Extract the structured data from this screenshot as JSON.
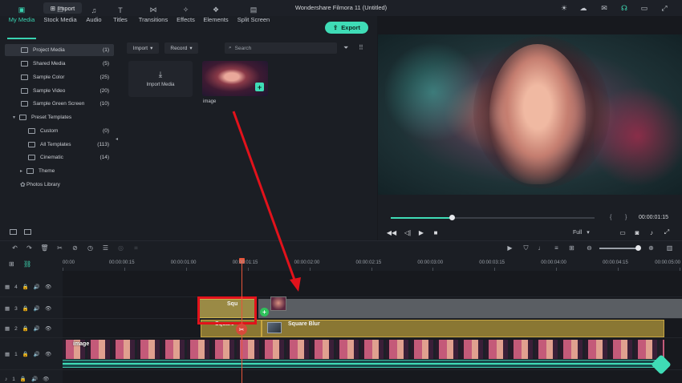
{
  "window": {
    "title": "Wondershare Filmora 11 (Untitled)",
    "import_button": "Import"
  },
  "tabs": [
    {
      "label": "My Media",
      "icon": "my-media-icon",
      "active": true
    },
    {
      "label": "Stock Media",
      "icon": "stock-media-icon"
    },
    {
      "label": "Audio",
      "icon": "audio-icon"
    },
    {
      "label": "Titles",
      "icon": "titles-icon"
    },
    {
      "label": "Transitions",
      "icon": "transitions-icon"
    },
    {
      "label": "Effects",
      "icon": "effects-icon"
    },
    {
      "label": "Elements",
      "icon": "elements-icon"
    },
    {
      "label": "Split Screen",
      "icon": "split-screen-icon"
    }
  ],
  "export_button": "Export",
  "sidebar": {
    "items": [
      {
        "label": "Project Media",
        "count": "(1)",
        "selected": true
      },
      {
        "label": "Shared Media",
        "count": "(5)"
      },
      {
        "label": "Sample Color",
        "count": "(25)"
      },
      {
        "label": "Sample Video",
        "count": "(20)"
      },
      {
        "label": "Sample Green Screen",
        "count": "(10)"
      },
      {
        "label": "Preset Templates",
        "count": ""
      },
      {
        "label": "Custom",
        "count": "(0)"
      },
      {
        "label": "All Templates",
        "count": "(113)"
      },
      {
        "label": "Cinematic",
        "count": "(14)"
      },
      {
        "label": "Theme",
        "count": ""
      },
      {
        "label": "Photos Library",
        "count": ""
      }
    ]
  },
  "media": {
    "import_dropdown": "Import",
    "record_dropdown": "Record",
    "search_placeholder": "Search",
    "import_tile_label": "Import Media",
    "image_tile_label": "image"
  },
  "preview": {
    "timecode": "00:00:01:15",
    "quality": "Full",
    "progress": 0.3
  },
  "ruler": {
    "labels": [
      "00:00",
      "00:00:00:15",
      "00:00:01:00",
      "00:00:01:15",
      "00:00:02:00",
      "00:00:02:15",
      "00:00:03:00",
      "00:00:03:15",
      "00:00:04:00",
      "00:00:04:15",
      "00:00:05:00"
    ]
  },
  "tracks": [
    {
      "number": "4"
    },
    {
      "number": "3"
    },
    {
      "number": "2"
    },
    {
      "number": "1"
    },
    {
      "number": "1"
    }
  ],
  "clips": {
    "square_top": "Squ",
    "square_bottom": "Square",
    "square_blur": "Square Blur",
    "image": "image"
  },
  "colors": {
    "accent": "#3fdcb6",
    "highlight": "#e2121b",
    "playhead": "#e8553a",
    "effect_clip": "#8a7733"
  }
}
